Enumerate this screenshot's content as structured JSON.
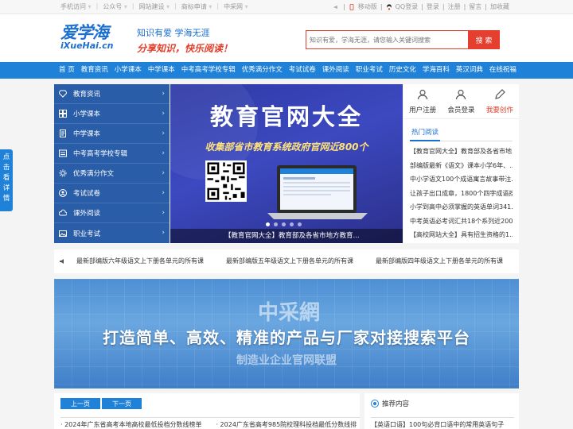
{
  "topbar": {
    "left_items": [
      "手机访问",
      "公众号",
      "网站建设",
      "商标申请",
      "中采网"
    ],
    "mobile": "移动版",
    "qq_login": "QQ登录",
    "login": "登录",
    "register": "注册",
    "message": "留言",
    "favorite": "加收藏"
  },
  "header": {
    "logo_cn": "爱学海",
    "logo_en": "iXueHai.cn",
    "slogan1": "知识有爱  学海无涯",
    "slogan2": "分享知识，快乐阅读！",
    "search_placeholder": "知识有爱，学海无涯，请您输入关键词搜索",
    "search_button": "搜 索"
  },
  "nav": [
    "首 页",
    "教育资讯",
    "小学课本",
    "中学课本",
    "中考高考学校专辑",
    "优秀满分作文",
    "考试试卷",
    "课外阅读",
    "职业考试",
    "历史文化",
    "学海百科",
    "英汉词典",
    "在线祝福"
  ],
  "float_tab": [
    "点",
    "击",
    "看",
    "详",
    "情"
  ],
  "categories": [
    "教育资讯",
    "小学课本",
    "中学课本",
    "中考高考学校专辑",
    "优秀满分作文",
    "考试试卷",
    "课外阅读",
    "职业考试"
  ],
  "banner": {
    "title": "教育官网大全",
    "subtitle": "收集部省市教育系统政府官网近800个",
    "caption": "【教育官网大全】教育部及各省市地方教育..."
  },
  "user_panel": {
    "register": "用户注册",
    "login": "会员登录",
    "create": "我要创作",
    "hot_tab": "热门阅读",
    "hot_list": [
      "【教育官网大全】教育部及各省市地...",
      "部编版最新《语文》课本小学6年、...",
      "中小学语文100个成语寓言故事带注...",
      "让孩子出口成章，1800个四字成语搜...",
      "小学到高中必须掌握的英语单词341...",
      "中考英语必考词汇共18个系列近200",
      "【高校网站大全】具有招生资格的1..."
    ]
  },
  "ticker": [
    "最新部编版六年级语文上下册各单元的所有课",
    "最新部编版五年级语文上下册各单元的所有课",
    "最新部编版四年级语文上下册各单元的所有课"
  ],
  "ad": {
    "brand": "中采網",
    "headline": "打造简单、高效、精准的产品与厂家对接搜索平台",
    "subline": "制造业企业官网联盟"
  },
  "news": {
    "prev": "上一页",
    "next": "下一页",
    "items": [
      "2024年广东省高考本地高校最低投档分数线榜单",
      "2024广东省高考985院校理科投档最低分数线排"
    ]
  },
  "recommend": {
    "title": "推荐内容",
    "first": "【英语口语】100句必背口语中的常用英语句子"
  },
  "colors": {
    "brand_blue": "#1f82d8",
    "accent_red": "#e5402f",
    "category_bg": "#2a5da8"
  }
}
